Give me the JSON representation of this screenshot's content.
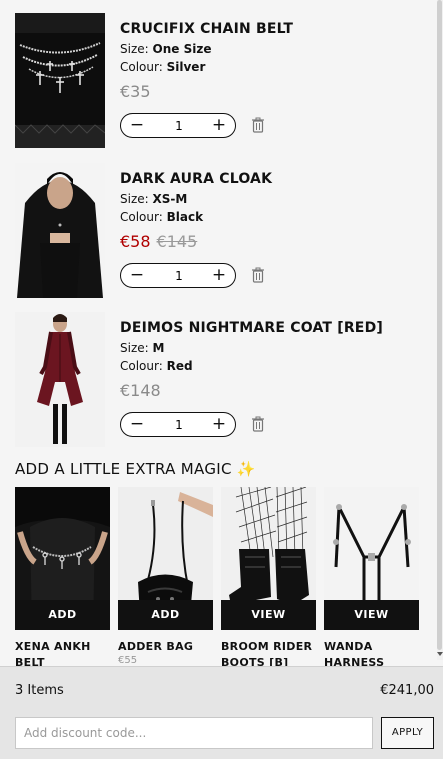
{
  "cart_items": [
    {
      "title": "CRUCIFIX CHAIN BELT",
      "size_label": "Size:",
      "size": "One Size",
      "colour_label": "Colour:",
      "colour": "Silver",
      "price": "€35",
      "old_price": "",
      "quantity": "1",
      "image_icon": "chain-belt-photo"
    },
    {
      "title": "DARK AURA CLOAK",
      "size_label": "Size:",
      "size": "XS-M",
      "colour_label": "Colour:",
      "colour": "Black",
      "price": "€58",
      "old_price": "€145",
      "quantity": "1",
      "image_icon": "cloak-photo"
    },
    {
      "title": "DEIMOS NIGHTMARE COAT [RED]",
      "size_label": "Size:",
      "size": "M",
      "colour_label": "Colour:",
      "colour": "Red",
      "price": "€148",
      "old_price": "",
      "quantity": "1",
      "image_icon": "red-coat-photo"
    }
  ],
  "upsell": {
    "title": "ADD A LITTLE EXTRA MAGIC",
    "title_icon": "sparkles-icon",
    "products": [
      {
        "name_line1": "XENA ANKH",
        "name_line2": "BELT",
        "price": "",
        "button": "ADD"
      },
      {
        "name_line1": "ADDER BAG",
        "name_line2": "",
        "price": "€55",
        "button": "ADD"
      },
      {
        "name_line1": "BROOM RIDER",
        "name_line2": "BOOTS [B]",
        "price": "",
        "button": "VIEW"
      },
      {
        "name_line1": "WANDA",
        "name_line2": "HARNESS",
        "price": "",
        "button": "VIEW"
      }
    ]
  },
  "footer": {
    "items_count": "3 Items",
    "total": "€241,00",
    "discount_placeholder": "Add discount code...",
    "apply_label": "APPLY"
  },
  "colors": {
    "sale_price": "#b00000",
    "price_grey": "#8a8a8a",
    "button_black": "#111111",
    "coat_red": "#6b1520"
  }
}
